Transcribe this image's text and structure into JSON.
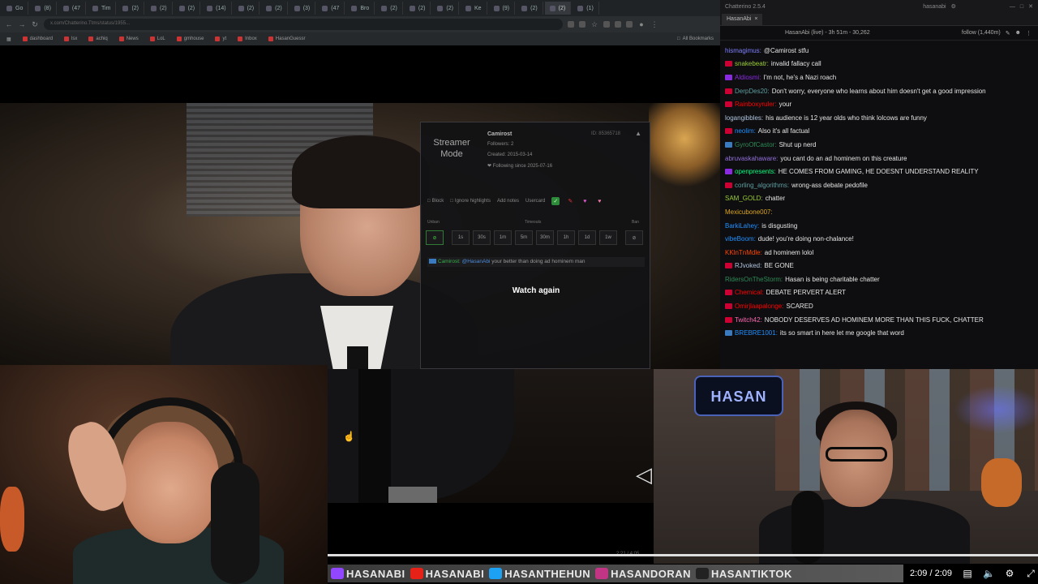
{
  "browser": {
    "tabs": [
      "Go",
      "(8)",
      "(47",
      "Tim",
      "(2)",
      "(2)",
      "(2)",
      "(14)",
      "(2)",
      "(2)",
      "(3)",
      "(47",
      "Bro",
      "(2)",
      "(2)",
      "(2)",
      "Ke",
      "(9)",
      "(2)",
      "(2)",
      "(1)"
    ],
    "url": "x.com/Chatterino.Ttms/status/1955...",
    "bookmarks": [
      "dashboard",
      "lsx",
      "achiq",
      "News",
      "LoL",
      "gmhouse",
      "yt",
      "Inbox",
      "HasanGuessr"
    ],
    "bookmarks_right": "All Bookmarks"
  },
  "popup": {
    "streamer_mode": "Streamer Mode",
    "user_name": "Camirost",
    "followers": "Followers: 2",
    "created": "Created: 2015-03-14",
    "following": "❤ Following since 2025-07-16",
    "user_id": "ID: 85365718",
    "actions": [
      "Block",
      "Ignore highlights",
      "Add notes",
      "Usercard"
    ],
    "label_unban": "Unban",
    "label_timeouts": "Timeouts",
    "label_ban": "Ban",
    "timeouts": [
      "1s",
      "30s",
      "1m",
      "5m",
      "30m",
      "1h",
      "1d",
      "1w"
    ],
    "msg_user": "Camirost:",
    "msg_mention": "@HasanAbi",
    "msg_text": "your better than doing ad hominem man",
    "watch_again": "Watch again"
  },
  "chat": {
    "app_title": "Chatterino 2.5.4",
    "account": "hasanabi",
    "tab": "HasanAbi",
    "header_left": "HasanAbi (live) - 3h 51m - 30,262",
    "header_right": "follow (1,440m)",
    "messages": [
      {
        "name": "hismagimus:",
        "text": "@Camirost stfu",
        "color": "#7f7fff",
        "badge": ""
      },
      {
        "name": "snakebeatr:",
        "text": "invalid fallacy call",
        "color": "#9acd32",
        "badge": "#c03"
      },
      {
        "name": "Aldiosmi:",
        "text": "I'm not, he's a Nazi roach",
        "color": "#8a2be2",
        "badge": "#8a2be2"
      },
      {
        "name": "DerpDes20:",
        "text": "Don't worry, everyone who learns about him doesn't get a good impression",
        "color": "#5f9ea0",
        "badge": "#c03"
      },
      {
        "name": "Rainboxyruler:",
        "text": "your",
        "color": "#ff0000",
        "badge": "#c03"
      },
      {
        "name": "logangibbles:",
        "text": "his audience is 12 year olds who think lolcows are funny",
        "color": "#b0c4de",
        "badge": ""
      },
      {
        "name": "neolim:",
        "text": "Also it's all factual",
        "color": "#1e90ff",
        "badge": "#c03"
      },
      {
        "name": "GyroOfCastor:",
        "text": "Shut up nerd",
        "color": "#2e8b57",
        "badge": "#3a7abf"
      },
      {
        "name": "abruvaskahaware:",
        "text": "you cant do an ad hominem on this creature",
        "color": "#9370db",
        "badge": ""
      },
      {
        "name": "openpresents:",
        "text": "HE COMES FROM GAMING, HE DOESNT UNDERSTAND REALITY",
        "color": "#00ff7f",
        "badge": "#8a2be2"
      },
      {
        "name": "corling_algorithms:",
        "text": "wrong-ass debate pedofile",
        "color": "#5f9ea0",
        "badge": "#c03"
      },
      {
        "name": "SAM_GOLD:",
        "text": "chatter",
        "color": "#9acd32",
        "badge": ""
      },
      {
        "name": "Mexicubone007:",
        "text": "",
        "color": "#daa520",
        "badge": ""
      },
      {
        "name": "BarkiLahey:",
        "text": "is disgusting",
        "color": "#1e90ff",
        "badge": ""
      },
      {
        "name": "vibeBoom:",
        "text": "dude! you're doing non-chalance!",
        "color": "#1e90ff",
        "badge": ""
      },
      {
        "name": "KKlnTnMdle:",
        "text": "ad hominem lolol",
        "color": "#ff4500",
        "badge": ""
      },
      {
        "name": "RJvoked:",
        "text": "BE GONE",
        "color": "#b0c4de",
        "badge": "#c03"
      },
      {
        "name": "RidersOnTheStorm:",
        "text": "Hasan is being charitable chatter",
        "color": "#2e8b57",
        "badge": ""
      },
      {
        "name": "Chemical:",
        "text": "DEBATE PERVERT ALERT",
        "color": "#ff0000",
        "badge": "#c03"
      },
      {
        "name": "Omirjlaapalonge:",
        "text": "SCARED",
        "color": "#ff0000",
        "badge": "#c03"
      },
      {
        "name": "Twitch42:",
        "text": "NOBODY DESERVES AD HOMINEM MORE THAN THIS FUCK, CHATTER",
        "color": "#ff69b4",
        "badge": "#c03"
      },
      {
        "name": "BREBRE1001:",
        "text": "its so smart in here let me google that word",
        "color": "#1e90ff",
        "badge": "#3a7abf"
      }
    ]
  },
  "cam_right": {
    "logo": "HASAN"
  },
  "player": {
    "mid_time": "2:21 / 4:05",
    "ticker": [
      "HASANABI",
      "HASANABI",
      "HASANTHEHUN",
      "HASANDORAN",
      "HASANTIKTOK"
    ],
    "time": "2:09 / 2:09",
    "progress": 1.0
  },
  "icons": {
    "settings": "gear-icon",
    "captions": "captions-icon",
    "volume": "volume-icon",
    "fullscreen": "fullscreen-icon"
  }
}
